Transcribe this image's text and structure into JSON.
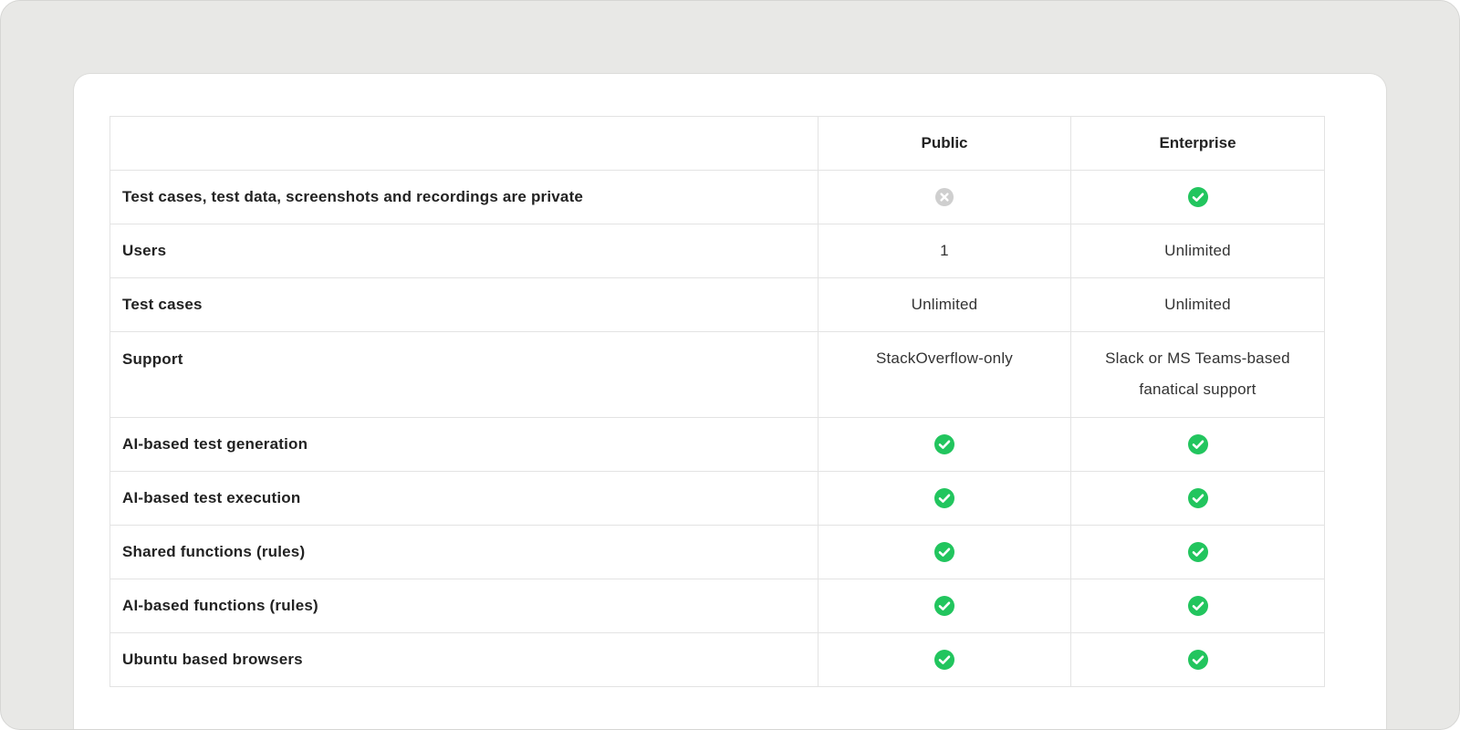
{
  "comparison": {
    "columns": [
      "",
      "Public",
      "Enterprise"
    ],
    "colors": {
      "check": "#22c55e",
      "cross": "#cfcfcf"
    },
    "rows": [
      {
        "feature": "Test cases, test data, screenshots and recordings are private",
        "public": {
          "kind": "icon",
          "icon": "cross-circle-icon",
          "text": ""
        },
        "enterprise": {
          "kind": "icon",
          "icon": "check-circle-icon",
          "text": ""
        }
      },
      {
        "feature": "Users",
        "public": {
          "kind": "text",
          "icon": "",
          "text": "1"
        },
        "enterprise": {
          "kind": "text",
          "icon": "",
          "text": "Unlimited"
        }
      },
      {
        "feature": "Test cases",
        "public": {
          "kind": "text",
          "icon": "",
          "text": "Unlimited"
        },
        "enterprise": {
          "kind": "text",
          "icon": "",
          "text": "Unlimited"
        }
      },
      {
        "feature": "Support",
        "public": {
          "kind": "text",
          "icon": "",
          "text": "StackOverflow-only"
        },
        "enterprise": {
          "kind": "text",
          "icon": "",
          "text": "Slack or MS Teams-based fanatical support"
        }
      },
      {
        "feature": "AI-based test generation",
        "public": {
          "kind": "icon",
          "icon": "check-circle-icon",
          "text": ""
        },
        "enterprise": {
          "kind": "icon",
          "icon": "check-circle-icon",
          "text": ""
        }
      },
      {
        "feature": "AI-based test execution",
        "public": {
          "kind": "icon",
          "icon": "check-circle-icon",
          "text": ""
        },
        "enterprise": {
          "kind": "icon",
          "icon": "check-circle-icon",
          "text": ""
        }
      },
      {
        "feature": "Shared functions (rules)",
        "public": {
          "kind": "icon",
          "icon": "check-circle-icon",
          "text": ""
        },
        "enterprise": {
          "kind": "icon",
          "icon": "check-circle-icon",
          "text": ""
        }
      },
      {
        "feature": "AI-based functions (rules)",
        "public": {
          "kind": "icon",
          "icon": "check-circle-icon",
          "text": ""
        },
        "enterprise": {
          "kind": "icon",
          "icon": "check-circle-icon",
          "text": ""
        }
      },
      {
        "feature": "Ubuntu based browsers",
        "public": {
          "kind": "icon",
          "icon": "check-circle-icon",
          "text": ""
        },
        "enterprise": {
          "kind": "icon",
          "icon": "check-circle-icon",
          "text": ""
        }
      }
    ]
  }
}
